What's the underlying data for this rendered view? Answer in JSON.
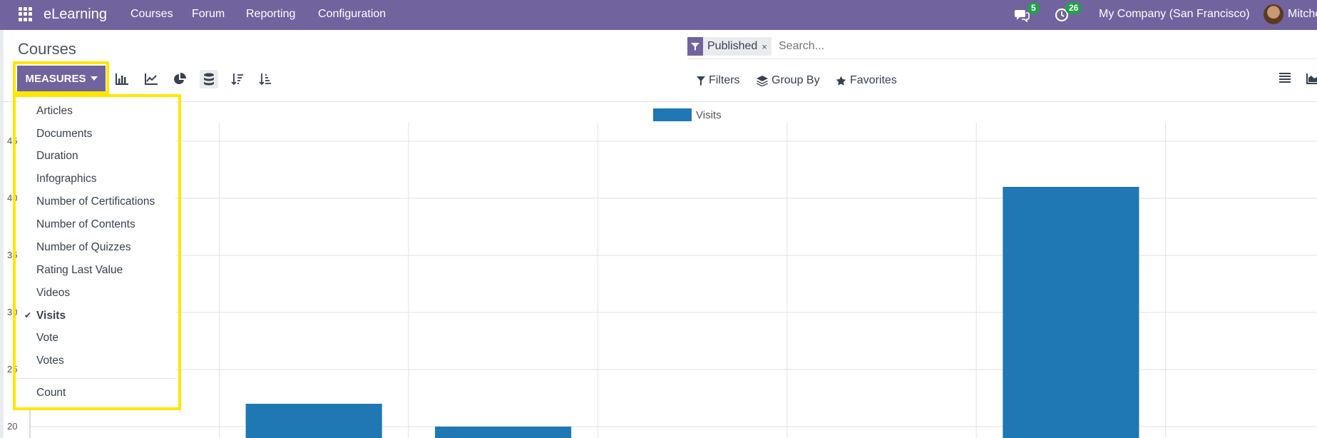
{
  "topbar": {
    "app_name": "eLearning",
    "menus": [
      "Courses",
      "Forum",
      "Reporting",
      "Configuration"
    ],
    "messages_count": "5",
    "activities_count": "26",
    "company": "My Company (San Francisco)",
    "user": "Mitche"
  },
  "control": {
    "title": "Courses",
    "facet": "Published",
    "facet_close": "×",
    "search_placeholder": "Search...",
    "measures_label": "MEASURES",
    "filters_label": "Filters",
    "groupby_label": "Group By",
    "favorites_label": "Favorites"
  },
  "dropdown": {
    "items": [
      "Articles",
      "Documents",
      "Duration",
      "Infographics",
      "Number of Certifications",
      "Number of Contents",
      "Number of Quizzs",
      "Rating Last Value",
      "Videos",
      "Visits",
      "Vote",
      "Votes"
    ],
    "selected": "Visits",
    "count_label": "Count"
  },
  "colors": {
    "navbar": "#71639e",
    "bar": "#1f77b4",
    "highlight": "#ffe600"
  },
  "chart_data": {
    "type": "bar",
    "legend": [
      "Visits"
    ],
    "series": [
      {
        "name": "Visits",
        "values": [
          22,
          20,
          41
        ]
      }
    ],
    "ylim": [
      19,
      46
    ],
    "yticks": [
      "45",
      "40",
      "35",
      "30",
      "25",
      "20"
    ]
  }
}
